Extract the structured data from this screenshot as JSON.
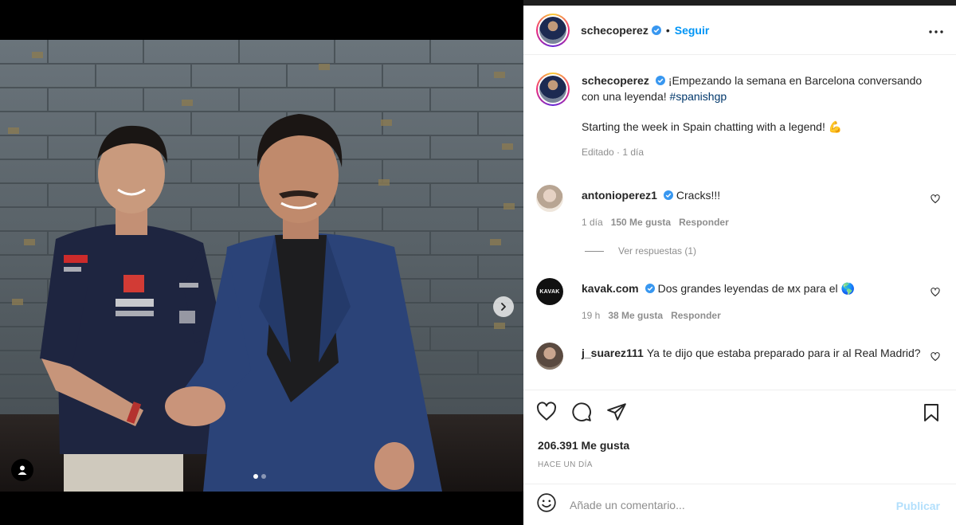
{
  "colors": {
    "accent": "#0095f6",
    "text": "#262626",
    "muted": "#8e8e8e",
    "hashtag": "#00376b",
    "publish_disabled": "#b2dffc",
    "verified": "#3897f0"
  },
  "header": {
    "username": "schecoperez",
    "separator": "•",
    "follow_label": "Seguir",
    "more_icon": "more-horizontal-icon"
  },
  "caption": {
    "username": "schecoperez",
    "text_es": "¡Empezando la semana en Barcelona conversando con una leyenda! ",
    "hashtag": "#spanishgp",
    "text_en": "Starting the week in Spain chatting with a legend! 💪",
    "meta": "Editado · 1 día"
  },
  "comments": [
    {
      "username": "antonioperez1",
      "verified": true,
      "text": "Cracks!!!",
      "time": "1 día",
      "likes": "150 Me gusta",
      "reply": "Responder",
      "view_replies": "Ver respuestas (1)"
    },
    {
      "username": "kavak.com",
      "verified": true,
      "text": "Dos grandes leyendas de ᴍx para el 🌎",
      "time": "19 h",
      "likes": "38 Me gusta",
      "reply": "Responder",
      "avatar_text": "KAVAK"
    },
    {
      "username": "j_suarez111",
      "verified": false,
      "text": "Ya te dijo que estaba preparado para ir al Real Madrid?"
    }
  ],
  "actions": {
    "like_icon": "heart-icon",
    "comment_icon": "comment-icon",
    "share_icon": "share-icon",
    "save_icon": "bookmark-icon"
  },
  "likes_text": "206.391 Me gusta",
  "posted_when": "HACE UN DÍA",
  "comment_box": {
    "placeholder": "Añade un comentario...",
    "publish_label": "Publicar"
  },
  "carousel": {
    "current": 1,
    "total": 2
  }
}
